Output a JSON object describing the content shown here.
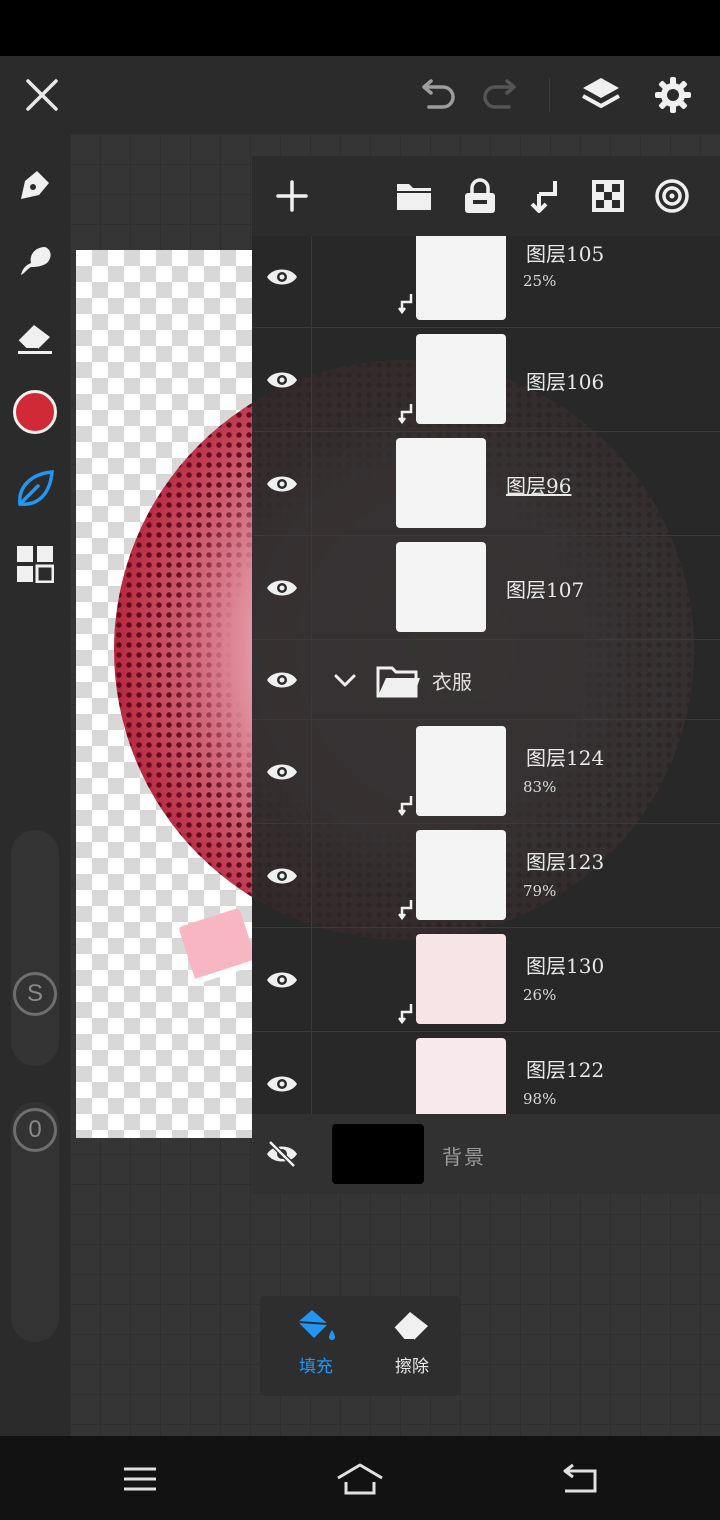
{
  "colors": {
    "accent": "#2196f3",
    "current_color": "#d12a36",
    "panel_bg": "#282828",
    "toolbar_bg": "#2b2b2b"
  },
  "top_bar": {
    "icons": [
      "close-icon",
      "undo-icon",
      "redo-icon",
      "layers-icon",
      "settings-icon"
    ]
  },
  "left_toolbar": {
    "tools": [
      "pen-icon",
      "smudge-icon",
      "eraser-icon",
      "color-swatch",
      "leaf-icon",
      "grid-icon"
    ],
    "size_slider_label": "S",
    "opacity_slider_label": "0"
  },
  "layer_panel": {
    "toolbar_icons": [
      "add-layer-icon",
      "new-folder-icon",
      "lock-icon",
      "merge-down-icon",
      "transparency-icon",
      "blend-icon"
    ],
    "layers": [
      {
        "name": "图层105",
        "opacity": "25%",
        "clipped": true
      },
      {
        "name": "图层106",
        "opacity": "",
        "clipped": true
      },
      {
        "name": "图层96",
        "opacity": "",
        "clipped": false,
        "selected": true
      },
      {
        "name": "图层107",
        "opacity": "",
        "clipped": false
      }
    ],
    "group": {
      "name": "衣服",
      "expanded": true
    },
    "group_layers": [
      {
        "name": "图层124",
        "opacity": "83%",
        "clipped": true
      },
      {
        "name": "图层123",
        "opacity": "79%",
        "clipped": true
      },
      {
        "name": "图层130",
        "opacity": "26%",
        "clipped": true
      },
      {
        "name": "图层122",
        "opacity": "98%",
        "clipped": true
      }
    ],
    "background": {
      "name": "背景",
      "visible": false,
      "color": "#000000"
    }
  },
  "fill_popup": {
    "fill_label": "填充",
    "erase_label": "擦除",
    "active": "fill"
  },
  "nav_bar": {
    "icons": [
      "menu-icon",
      "home-icon",
      "back-icon"
    ]
  }
}
